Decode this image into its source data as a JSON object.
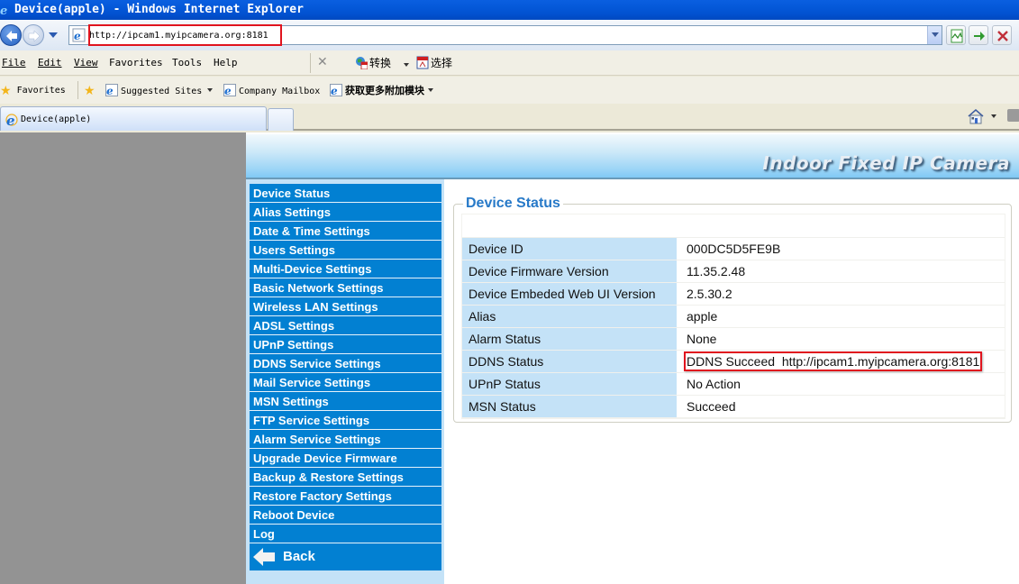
{
  "window": {
    "title": "Device(apple) - Windows Internet Explorer"
  },
  "address_bar": {
    "url": "http://ipcam1.myipcamera.org:8181"
  },
  "menu_bar": {
    "items": [
      {
        "label": "File",
        "accel": "F"
      },
      {
        "label": "Edit",
        "accel": "E"
      },
      {
        "label": "View",
        "accel": "V"
      },
      {
        "label": "Favorites",
        "accel": "a"
      },
      {
        "label": "Tools",
        "accel": "T"
      },
      {
        "label": "Help",
        "accel": "H"
      }
    ],
    "pdf_convert_label": "转换",
    "pdf_select_label": "选择"
  },
  "favorites_bar": {
    "favorites_label": "Favorites",
    "links": [
      {
        "label": "Suggested Sites",
        "has_dropdown": true
      },
      {
        "label": "Company Mailbox",
        "has_dropdown": false
      },
      {
        "label": "获取更多附加模块",
        "has_dropdown": true
      }
    ]
  },
  "tabs": [
    {
      "label": "Device(apple)",
      "active": true
    }
  ],
  "page": {
    "banner_title": "Indoor Fixed IP Camera",
    "sidebar": {
      "items": [
        "Device Status",
        "Alias Settings",
        "Date & Time Settings",
        "Users Settings",
        "Multi-Device Settings",
        "Basic Network Settings",
        "Wireless LAN Settings",
        "ADSL Settings",
        "UPnP Settings",
        "DDNS Service Settings",
        "Mail Service Settings",
        "MSN Settings",
        "FTP Service Settings",
        "Alarm Service Settings",
        "Upgrade Device Firmware",
        "Backup & Restore Settings",
        "Restore Factory Settings",
        "Reboot Device",
        "Log"
      ],
      "back_label": "Back"
    },
    "status": {
      "heading": "Device Status",
      "rows": [
        {
          "label": "Device ID",
          "value": "000DC5D5FE9B"
        },
        {
          "label": "Device Firmware Version",
          "value": "11.35.2.48"
        },
        {
          "label": "Device Embeded Web UI Version",
          "value": "2.5.30.2"
        },
        {
          "label": "Alias",
          "value": "apple"
        },
        {
          "label": "Alarm Status",
          "value": "None"
        },
        {
          "label": "DDNS Status",
          "value": "DDNS Succeed  http://ipcam1.myipcamera.org:8181"
        },
        {
          "label": "UPnP Status",
          "value": "No Action"
        },
        {
          "label": "MSN Status",
          "value": "Succeed"
        }
      ]
    }
  },
  "colors": {
    "sidebar_item_bg": "#0280d2",
    "sidebar_bg": "#c4e2f7",
    "label_cell_bg": "#c4e2f7",
    "heading_color": "#2779c8",
    "highlight_red": "#e0141e"
  }
}
